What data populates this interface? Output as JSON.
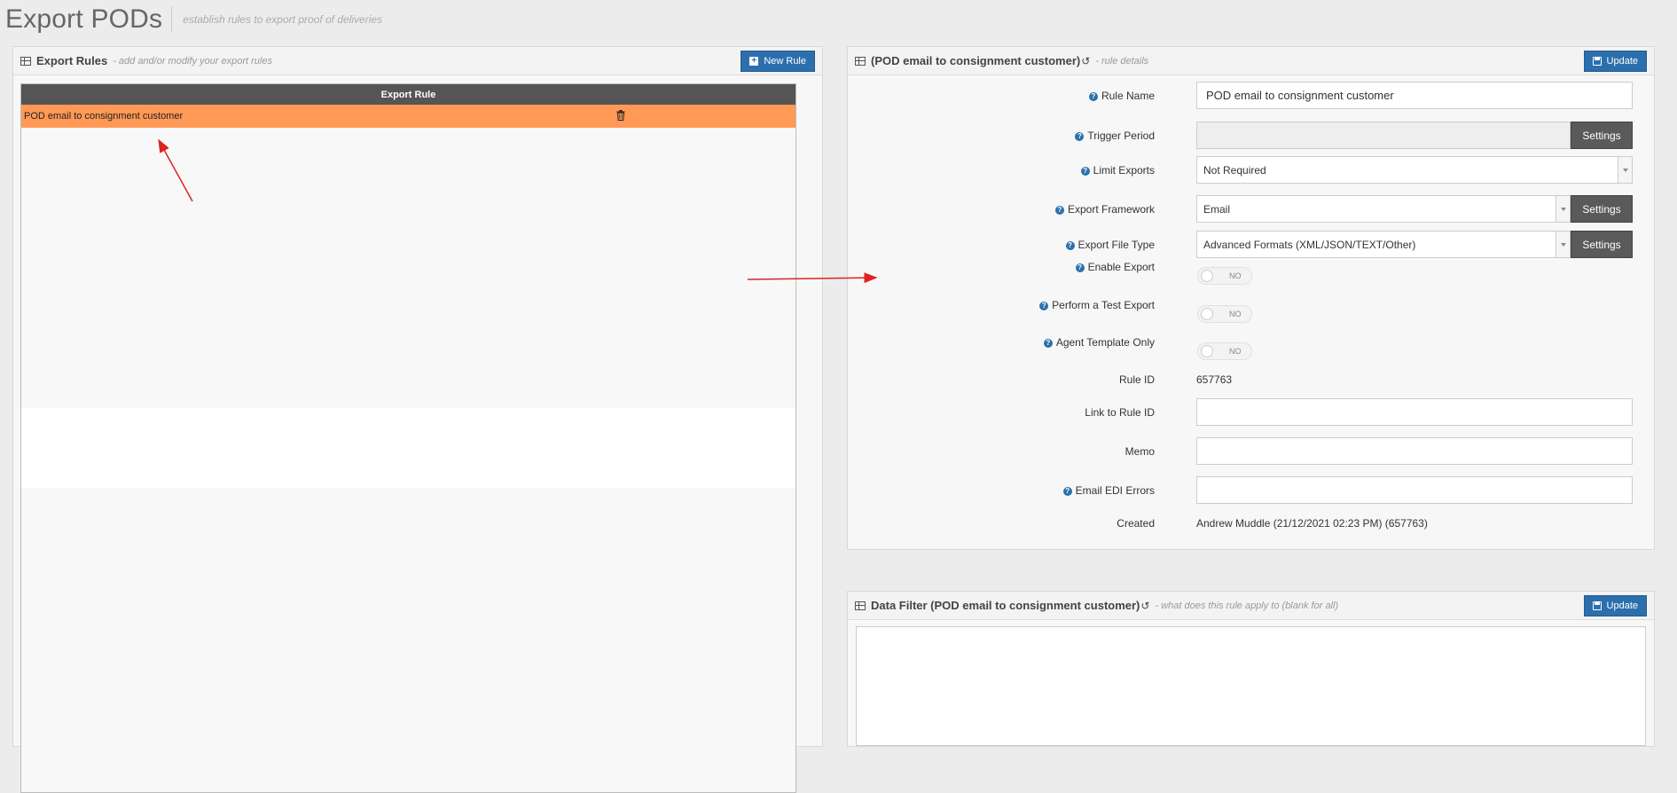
{
  "page": {
    "title": "Export PODs",
    "subtitle": "establish rules to export proof of deliveries"
  },
  "left_panel": {
    "title": "Export Rules",
    "subtitle": "- add and/or modify your export rules",
    "new_button": "New Rule",
    "table": {
      "header": "Export Rule",
      "rows": [
        {
          "name": "POD email to consignment customer",
          "selected": true
        }
      ]
    }
  },
  "details_panel": {
    "title": "(POD email to consignment customer)",
    "subtitle": "- rule details",
    "update_button": "Update",
    "fields": {
      "rule_name": {
        "label": "Rule Name",
        "value": "POD email to consignment customer"
      },
      "trigger_period": {
        "label": "Trigger Period",
        "value": "",
        "button": "Settings"
      },
      "limit_exports": {
        "label": "Limit Exports",
        "value": "Not Required"
      },
      "export_framework": {
        "label": "Export Framework",
        "value": "Email",
        "button": "Settings"
      },
      "export_file_type": {
        "label": "Export File Type",
        "value": "Advanced Formats (XML/JSON/TEXT/Other)",
        "button": "Settings"
      },
      "enable_export": {
        "label": "Enable Export",
        "state": "NO"
      },
      "test_export": {
        "label": "Perform a Test Export",
        "state": "NO"
      },
      "agent_template": {
        "label": "Agent Template Only",
        "state": "NO"
      },
      "rule_id": {
        "label": "Rule ID",
        "value": "657763"
      },
      "link_rule_id": {
        "label": "Link to Rule ID",
        "value": ""
      },
      "memo": {
        "label": "Memo",
        "value": ""
      },
      "email_edi_errors": {
        "label": "Email EDI Errors",
        "value": ""
      },
      "created": {
        "label": "Created",
        "value": "Andrew Muddle (21/12/2021 02:23 PM) (657763)"
      }
    }
  },
  "filter_panel": {
    "title": "Data Filter (POD email to consignment customer)",
    "subtitle": "- what does this rule apply to (blank for all)",
    "update_button": "Update"
  },
  "colors": {
    "accent_blue": "#2c6fad",
    "selected_row": "#ff9955",
    "table_header": "#555555",
    "annotation_arrow": "#dd2222"
  }
}
